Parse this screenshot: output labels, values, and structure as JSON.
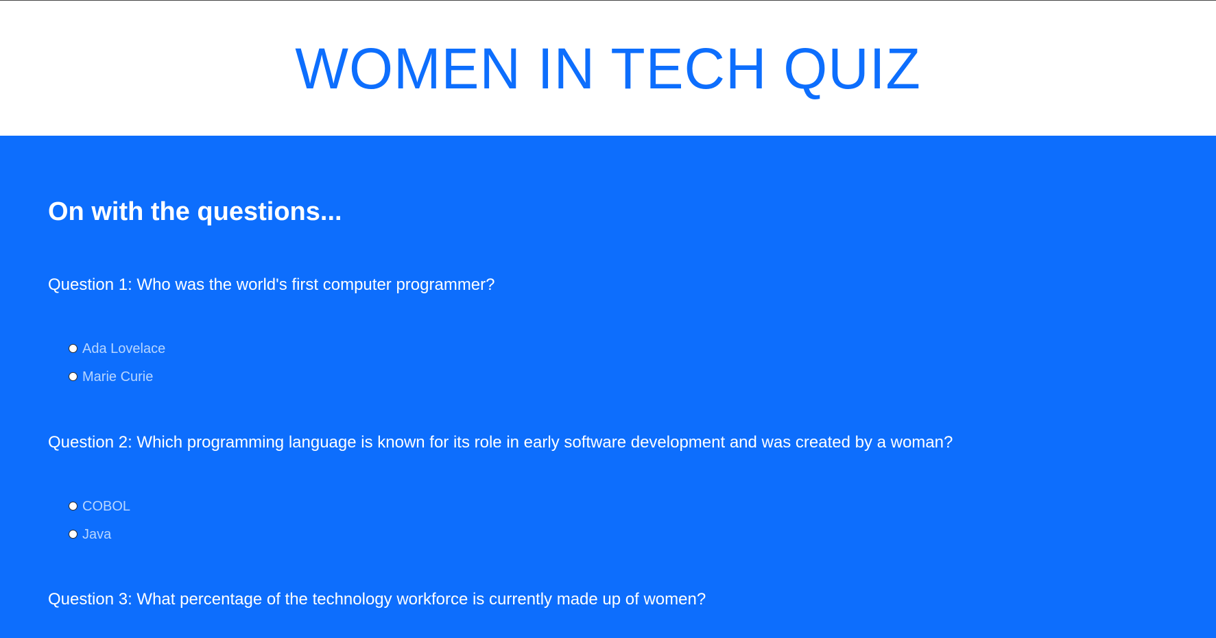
{
  "header": {
    "title": "WOMEN IN TECH QUIZ"
  },
  "main": {
    "section_heading": "On with the questions...",
    "questions": [
      {
        "text": "Question 1: Who was the world's first computer programmer?",
        "options": [
          "Ada Lovelace",
          "Marie Curie"
        ]
      },
      {
        "text": "Question 2: Which programming language is known for its role in early software development and was created by a woman?",
        "options": [
          "COBOL",
          "Java"
        ]
      },
      {
        "text": "Question 3: What percentage of the technology workforce is currently made up of women?"
      }
    ]
  },
  "colors": {
    "primary": "#0d6efd",
    "white": "#ffffff",
    "option_text": "#b8d6ff"
  }
}
